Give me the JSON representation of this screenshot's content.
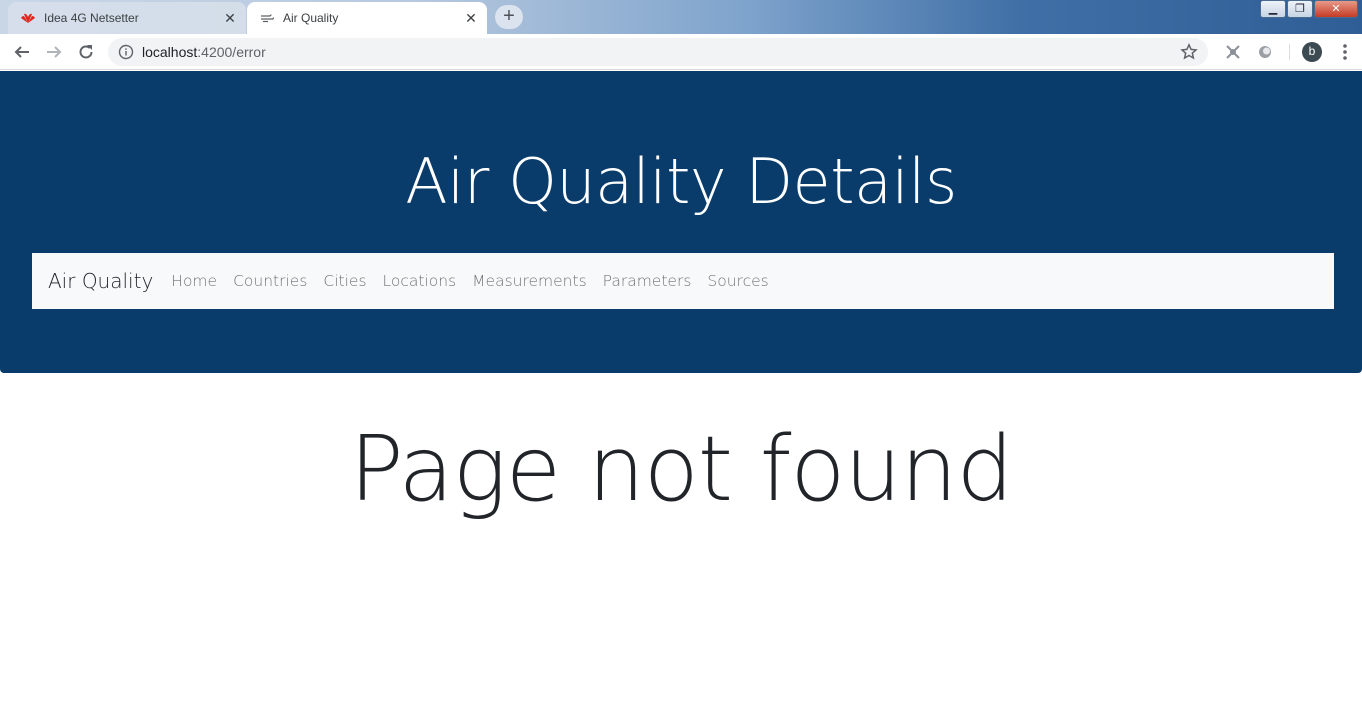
{
  "browser": {
    "tabs": [
      {
        "title": "Idea 4G Netsetter",
        "active": false,
        "icon": "huawei-logo-icon"
      },
      {
        "title": "Air Quality",
        "active": true,
        "icon": "air-quality-favicon-icon"
      }
    ],
    "url_host": "localhost",
    "url_path": ":4200/error",
    "profile_initial": "b"
  },
  "page": {
    "jumbotron_title": "Air Quality Details",
    "brand": "Air Quality",
    "nav_links": [
      "Home",
      "Countries",
      "Cities",
      "Locations",
      "Measurements",
      "Parameters",
      "Sources"
    ],
    "message": "Page not found"
  },
  "colors": {
    "jumbotron_bg": "#093c6b",
    "navbar_bg": "#f8f9fa"
  }
}
